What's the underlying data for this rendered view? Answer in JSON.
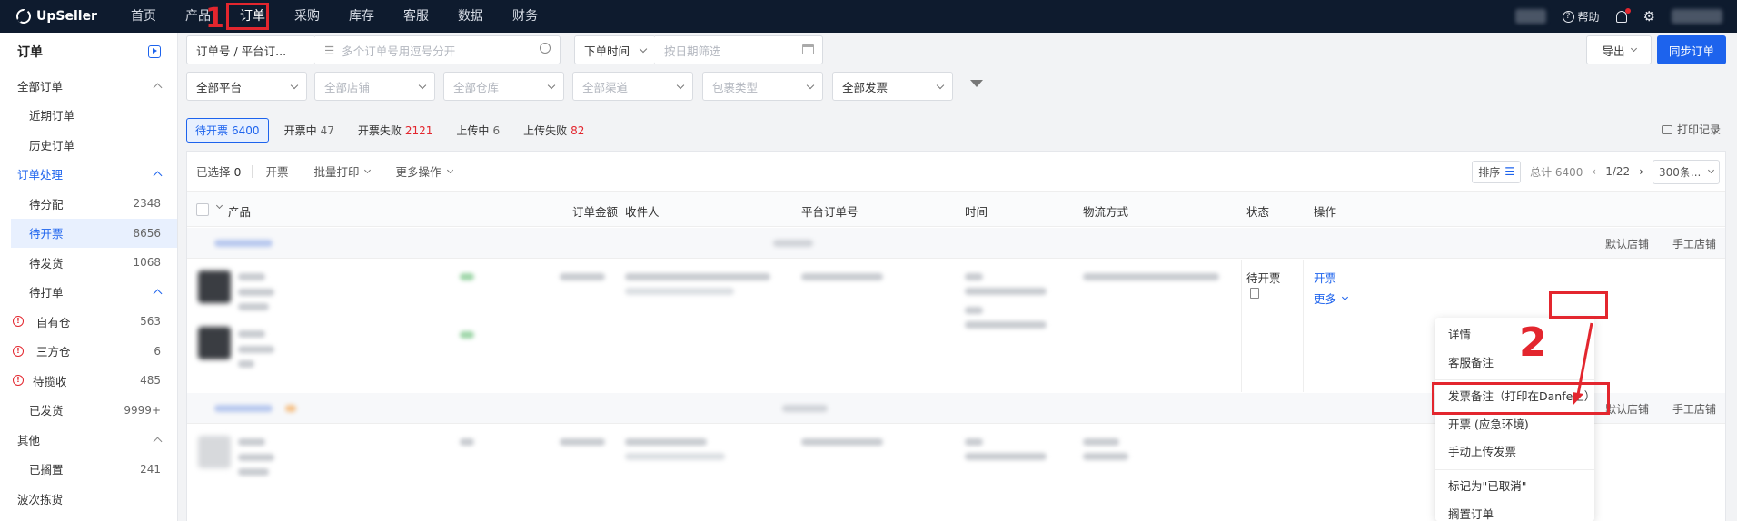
{
  "app": {
    "name": "UpSeller"
  },
  "nav": {
    "items": [
      "首页",
      "产品",
      "订单",
      "采购",
      "库存",
      "客服",
      "数据",
      "财务"
    ],
    "active": "订单",
    "help": "帮助"
  },
  "annotations": {
    "one": "1",
    "two": "2"
  },
  "sidebar": {
    "title": "订单",
    "all_orders": "全部订单",
    "recent": "近期订单",
    "history": "历史订单",
    "processing": "订单处理",
    "to_assign": {
      "label": "待分配",
      "count": "2348"
    },
    "to_invoice": {
      "label": "待开票",
      "count": "8656"
    },
    "to_ship": {
      "label": "待发货",
      "count": "1068"
    },
    "to_print": "待打单",
    "own_wh": {
      "label": "自有仓",
      "count": "563"
    },
    "third_wh": {
      "label": "三方仓",
      "count": "6"
    },
    "to_pickup": {
      "label": "待揽收",
      "count": "485"
    },
    "shipped": {
      "label": "已发货",
      "count": "9999+"
    },
    "other": "其他",
    "on_hold": {
      "label": "已搁置",
      "count": "241"
    },
    "wave_pick": "波次拣货"
  },
  "filters": {
    "search_type": "订单号 / 平台订...",
    "search_placeholder": "多个订单号用逗号分开",
    "time_type": "下单时间",
    "date_placeholder": "按日期筛选",
    "platform": "全部平台",
    "store": "全部店铺",
    "warehouse": "全部仓库",
    "channel": "全部渠道",
    "package": "包裹类型",
    "invoice": "全部发票"
  },
  "buttons": {
    "export": "导出",
    "sync": "同步订单",
    "print_log": "打印记录"
  },
  "tabs": [
    {
      "label": "待开票",
      "count": "6400"
    },
    {
      "label": "开票中",
      "count": "47"
    },
    {
      "label": "开票失败",
      "count": "2121"
    },
    {
      "label": "上传中",
      "count": "6"
    },
    {
      "label": "上传失败",
      "count": "82"
    }
  ],
  "actions": {
    "selected_label": "已选择",
    "selected_count": "0",
    "invoice": "开票",
    "batch_print": "批量打印",
    "more_ops": "更多操作",
    "sort": "排序",
    "total": "总计 6400",
    "page": "1/22",
    "page_size": "300条..."
  },
  "columns": [
    "产品",
    "订单金额",
    "收件人",
    "平台订单号",
    "时间",
    "物流方式",
    "状态",
    "操作"
  ],
  "group_links": {
    "default_store": "默认店铺",
    "manual_store": "手工店铺"
  },
  "order": {
    "status": "待开票",
    "op_invoice": "开票",
    "op_more": "更多"
  },
  "menu": {
    "items": [
      "详情",
      "客服备注",
      "发票备注（打印在Danfe上）",
      "开票 (应急环境)",
      "手动上传发票",
      "标记为\"已取消\"",
      "搁置订单"
    ]
  },
  "colors": {
    "accent": "#1d63ed",
    "annotation": "#e3262e",
    "topbar": "#0e1b2e"
  }
}
